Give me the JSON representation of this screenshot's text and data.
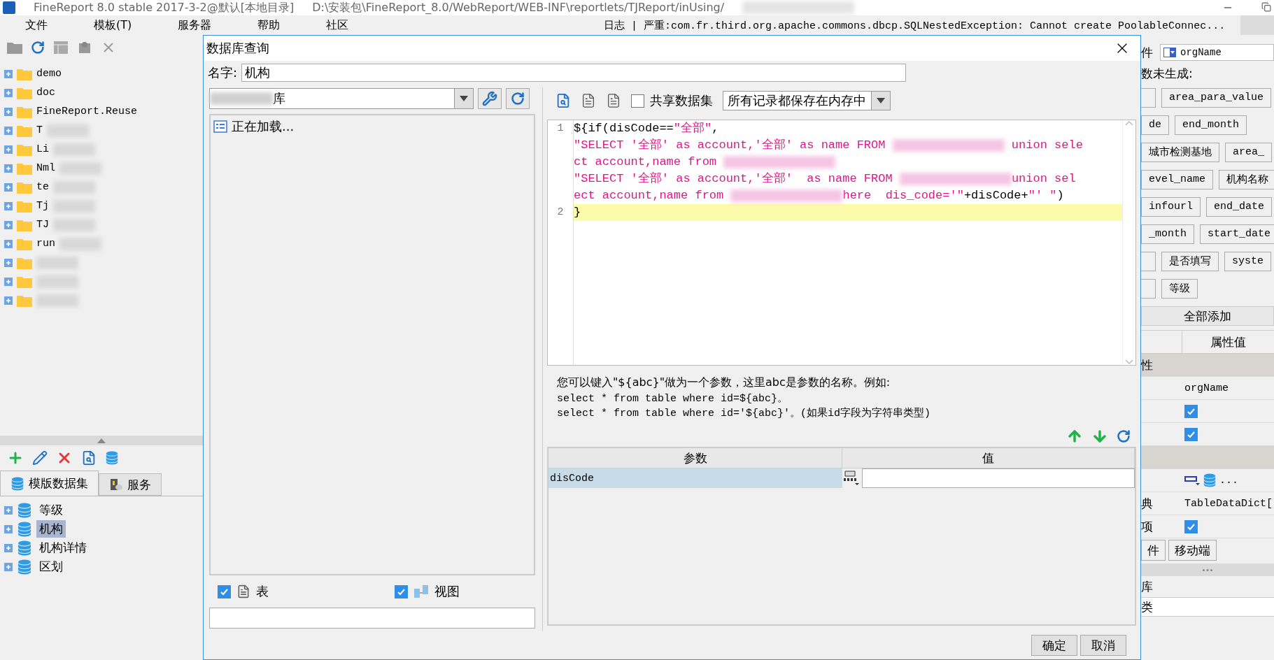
{
  "window": {
    "title": "FineReport 8.0 stable 2017-3-2@默认[本地目录]",
    "path": "D:\\安装包\\FineReport_8.0/WebReport/WEB-INF\\reportlets/TJReport/inUsing/"
  },
  "menu": [
    "文件",
    "模板(T)",
    "服务器",
    "帮助",
    "社区"
  ],
  "log": {
    "label": "日志",
    "separator": "|",
    "message": "严重:com.fr.third.org.apache.commons.dbcp.SQLNestedException: Cannot create PoolableConnec..."
  },
  "template_tree": [
    {
      "label": "demo",
      "redacted": false
    },
    {
      "label": "doc",
      "redacted": false
    },
    {
      "label": "FineReport.Reuse",
      "redacted": false
    },
    {
      "label": "T",
      "redacted": true
    },
    {
      "label": "Li",
      "redacted": true
    },
    {
      "label": "Nml",
      "redacted": true
    },
    {
      "label": "te",
      "redacted": true
    },
    {
      "label": "Tj",
      "redacted": true
    },
    {
      "label": "TJ",
      "redacted": true
    },
    {
      "label": "run",
      "redacted": true
    },
    {
      "redacted": true
    },
    {
      "redacted": true
    },
    {
      "redacted": true
    }
  ],
  "dataset_tabs": [
    {
      "label": "模版数据集",
      "selected": true
    },
    {
      "label": "服务",
      "selected": false
    }
  ],
  "datasets": [
    {
      "label": "等级",
      "selected": false
    },
    {
      "label": "机构",
      "selected": true
    },
    {
      "label": "机构详情",
      "selected": false
    },
    {
      "label": "区划",
      "selected": false
    }
  ],
  "dialog": {
    "title": "数据库查询",
    "name_label": "名字:",
    "name_value": "机构",
    "connection": "库",
    "loading": "正在加载...",
    "filters": [
      {
        "label": "表",
        "checked": true
      },
      {
        "label": "视图",
        "checked": true
      }
    ],
    "share": {
      "label": "共享数据集",
      "checked": false
    },
    "storage": "所有记录都保存在内存中",
    "code": [
      {
        "number": "1",
        "highlighted": false,
        "rows": [
          {
            "parts": [
              {
                "kind": "plain",
                "text": "${if(disCode=="
              },
              {
                "kind": "string",
                "text": "\"全部\""
              },
              {
                "kind": "plain",
                "text": ","
              }
            ]
          },
          {
            "parts": [
              {
                "kind": "string",
                "text": "\"SELECT '全部' as account,'全部' as name FROM "
              },
              {
                "kind": "redacted"
              },
              {
                "kind": "string",
                "text": " union sele"
              }
            ]
          },
          {
            "parts": [
              {
                "kind": "string",
                "text": "ct account,name from "
              },
              {
                "kind": "redacted"
              }
            ]
          },
          {
            "parts": [
              {
                "kind": "string",
                "text": "\"SELECT '全部' as account,'全部'  as name FROM "
              },
              {
                "kind": "redacted"
              },
              {
                "kind": "string",
                "text": "union sel"
              }
            ]
          },
          {
            "parts": [
              {
                "kind": "string",
                "text": "ect account,name from "
              },
              {
                "kind": "redacted"
              },
              {
                "kind": "string",
                "text": "here  dis_code='\""
              },
              {
                "kind": "plain",
                "text": "+disCode+"
              },
              {
                "kind": "string",
                "text": "\"' \""
              },
              {
                "kind": "plain",
                "text": ")"
              }
            ]
          }
        ]
      },
      {
        "number": "2",
        "highlighted": true,
        "rows": [
          {
            "parts": [
              {
                "kind": "plain",
                "text": "}"
              }
            ]
          }
        ]
      }
    ],
    "hint": [
      "您可以键入\"${abc}\"做为一个参数，这里abc是参数的名称。例如:",
      "select * from table where id=${abc}。",
      "select * from table where id='${abc}'。(如果id字段为字符串类型)"
    ],
    "param_columns": [
      "参数",
      "值"
    ],
    "params": [
      {
        "name": "disCode",
        "selected": true
      }
    ],
    "buttons": [
      "确定",
      "取消"
    ]
  },
  "right_panel": {
    "widget_label": "件",
    "widget_name": "orgName",
    "note": "数未生成:",
    "field_rows": [
      [
        {},
        {
          "label": "area_para_value"
        }
      ],
      [
        {
          "label": "de"
        },
        {
          "label": "end_month"
        }
      ],
      [
        {
          "label": "城市检测基地"
        },
        {
          "label": "area_"
        }
      ],
      [
        {
          "label": "evel_name"
        },
        {
          "label": "机构名称"
        }
      ],
      [
        {
          "label": "infourl"
        },
        {
          "label": "end_date"
        }
      ],
      [
        {
          "label": "_month"
        },
        {
          "label": "start_date"
        }
      ],
      [
        {},
        {
          "label": "是否填写"
        },
        {
          "label": "syste"
        }
      ],
      [
        {},
        {
          "label": "等级"
        }
      ]
    ],
    "add_all": "全部添加",
    "property_header": "属性值",
    "properties": [
      {
        "kind": "section",
        "label": "性"
      },
      {
        "kind": "text",
        "value": "orgName"
      },
      {
        "kind": "check",
        "checked": true
      },
      {
        "kind": "check",
        "checked": true
      },
      {
        "kind": "section"
      },
      {
        "kind": "widget",
        "value": "..."
      },
      {
        "kind": "text",
        "label": "典",
        "value": "TableDataDict["
      },
      {
        "kind": "check",
        "label": "项",
        "checked": true
      }
    ],
    "tabs": [
      {
        "label": "件",
        "selected": false
      },
      {
        "label": "移动端",
        "selected": false
      }
    ],
    "bottom_label": "库",
    "bottom_field": "类"
  }
}
